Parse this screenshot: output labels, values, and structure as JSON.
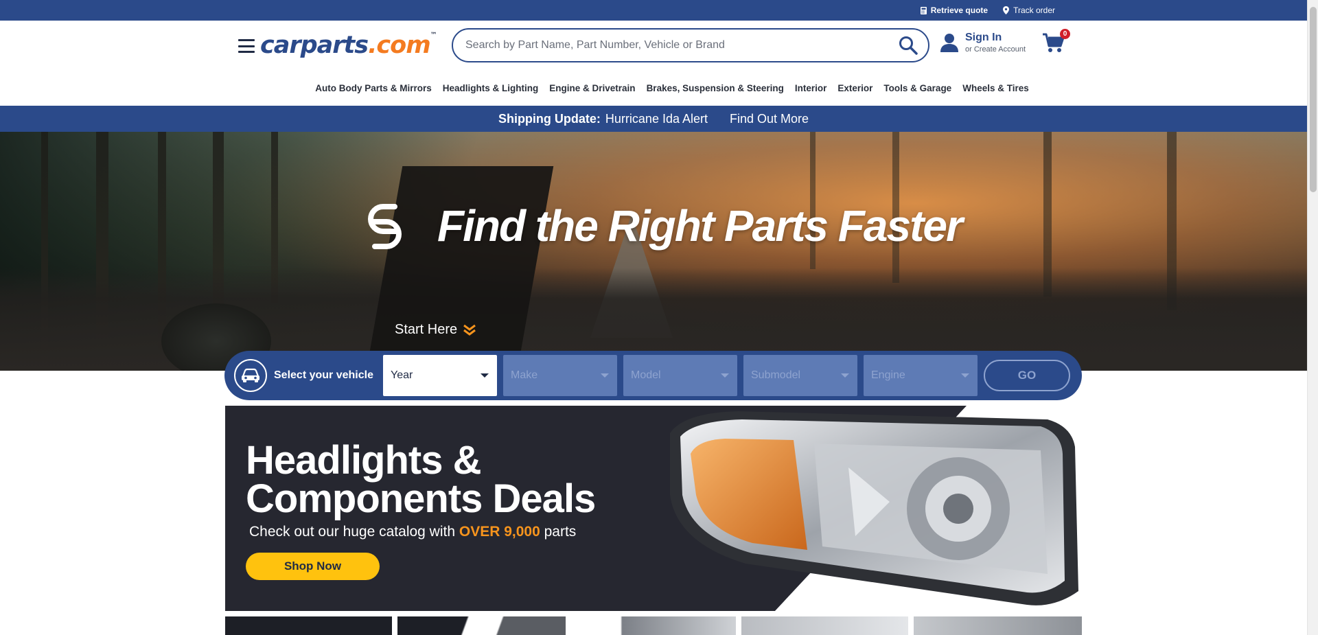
{
  "utility": {
    "retrieve_quote": "Retrieve quote",
    "track_order": "Track order"
  },
  "header": {
    "logo_main": "carparts",
    "logo_dotcom": ".com",
    "logo_tm": "™",
    "search_placeholder": "Search by Part Name, Part Number, Vehicle or Brand",
    "sign_in": "Sign In",
    "create_account": "or Create Account",
    "cart_count": "0"
  },
  "categories": [
    "Auto Body Parts & Mirrors",
    "Headlights & Lighting",
    "Engine & Drivetrain",
    "Brakes, Suspension & Steering",
    "Interior",
    "Exterior",
    "Tools & Garage",
    "Wheels & Tires"
  ],
  "shipping": {
    "label": "Shipping Update:",
    "alert": "Hurricane Ida Alert",
    "link": "Find Out More"
  },
  "hero": {
    "title": "Find the Right Parts Faster",
    "start_here": "Start Here"
  },
  "vehicle": {
    "label": "Select your vehicle",
    "selects": [
      {
        "label": "Year",
        "enabled": true
      },
      {
        "label": "Make",
        "enabled": false
      },
      {
        "label": "Model",
        "enabled": false
      },
      {
        "label": "Submodel",
        "enabled": false
      },
      {
        "label": "Engine",
        "enabled": false
      }
    ],
    "go": "GO"
  },
  "promo": {
    "title_line1": "Headlights &",
    "title_line2": "Components Deals",
    "sub_prefix": "Check out our huge catalog with",
    "sub_highlight": "OVER 9,000",
    "sub_suffix": "parts",
    "button": "Shop Now"
  },
  "colors": {
    "brand_blue": "#2b4a8a",
    "accent_orange": "#f47b20",
    "cta_yellow": "#ffc20e",
    "badge_red": "#d11f2a"
  }
}
